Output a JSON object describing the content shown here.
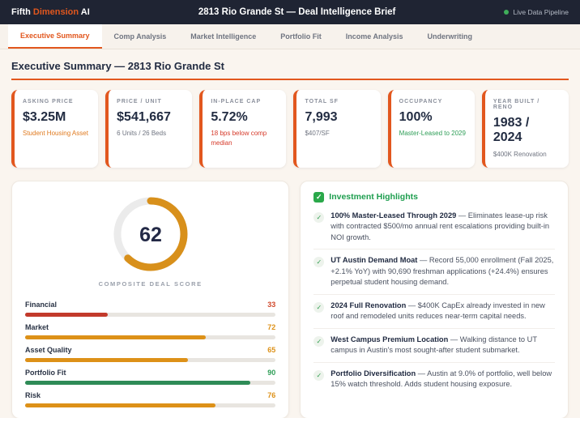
{
  "colors": {
    "accent_orange": "#e2571e",
    "amber": "#dd9118",
    "red": "#c23a2b",
    "green": "#2e8b57",
    "green_text": "#1e9e4f",
    "navy": "#1f2433"
  },
  "header": {
    "brand_part1": "Fifth",
    "brand_part2": "Dimension",
    "brand_part3": "AI",
    "title": "2813 Rio Grande St — Deal Intelligence Brief",
    "status": "Live Data Pipeline"
  },
  "tabs": [
    {
      "label": "Executive Summary",
      "active": true
    },
    {
      "label": "Comp Analysis",
      "active": false
    },
    {
      "label": "Market Intelligence",
      "active": false
    },
    {
      "label": "Portfolio Fit",
      "active": false
    },
    {
      "label": "Income Analysis",
      "active": false
    },
    {
      "label": "Underwriting",
      "active": false
    }
  ],
  "section_title": "Executive Summary — 2813 Rio Grande St",
  "kpis": [
    {
      "label": "ASKING PRICE",
      "value": "$3.25M",
      "sub": "Student Housing Asset",
      "sub_color": "#e07a1f"
    },
    {
      "label": "PRICE / UNIT",
      "value": "$541,667",
      "sub": "6 Units / 26 Beds",
      "sub_color": "#6f7480"
    },
    {
      "label": "IN-PLACE CAP",
      "value": "5.72%",
      "sub": "18 bps below comp median",
      "sub_color": "#d63b2b"
    },
    {
      "label": "TOTAL SF",
      "value": "7,993",
      "sub": "$407/SF",
      "sub_color": "#6f7480"
    },
    {
      "label": "OCCUPANCY",
      "value": "100%",
      "sub": "Master-Leased to 2029",
      "sub_color": "#2e9e57"
    },
    {
      "label": "YEAR BUILT / RENO",
      "value": "1983 / 2024",
      "sub": "$400K Renovation",
      "sub_color": "#6f7480"
    }
  ],
  "chart_data": [
    {
      "type": "donut-gauge",
      "title": "COMPOSITE DEAL SCORE",
      "value": 62,
      "max": 100,
      "arc_color": "#d8901b",
      "track_color": "#ebebeb"
    },
    {
      "type": "bar",
      "title": "Deal score components",
      "categories": [
        "Financial",
        "Market",
        "Asset Quality",
        "Portfolio Fit",
        "Risk"
      ],
      "values": [
        33,
        72,
        65,
        90,
        76
      ],
      "colors": [
        "#c23a2b",
        "#dd9118",
        "#dd9118",
        "#2e8b57",
        "#dd9118"
      ],
      "xlim": [
        0,
        100
      ]
    }
  ],
  "deal_score": {
    "score": "62",
    "label": "COMPOSITE DEAL SCORE",
    "bars": [
      {
        "name": "Financial",
        "value": 33,
        "color": "#c23a2b",
        "value_color": "#d1492c"
      },
      {
        "name": "Market",
        "value": 72,
        "color": "#dd9118",
        "value_color": "#dd9118"
      },
      {
        "name": "Asset Quality",
        "value": 65,
        "color": "#dd9118",
        "value_color": "#dd9118"
      },
      {
        "name": "Portfolio Fit",
        "value": 90,
        "color": "#2e8b57",
        "value_color": "#2e9e57"
      },
      {
        "name": "Risk",
        "value": 76,
        "color": "#dd9118",
        "value_color": "#dd9118"
      }
    ]
  },
  "highlights": {
    "title": "Investment Highlights",
    "badge_icon": "check",
    "items": [
      {
        "title": "100% Master-Leased Through 2029",
        "body": "— Eliminates lease-up risk with contracted $500/mo annual rent escalations providing built-in NOI growth."
      },
      {
        "title": "UT Austin Demand Moat",
        "body": "— Record 55,000 enrollment (Fall 2025, +2.1% YoY) with 90,690 freshman applications (+24.4%) ensures perpetual student housing demand."
      },
      {
        "title": "2024 Full Renovation",
        "body": "— $400K CapEx already invested in new roof and remodeled units reduces near-term capital needs."
      },
      {
        "title": "West Campus Premium Location",
        "body": "— Walking distance to UT campus in Austin's most sought-after student submarket."
      },
      {
        "title": "Portfolio Diversification",
        "body": "— Austin at 9.0% of portfolio, well below 15% watch threshold. Adds student housing exposure."
      }
    ]
  }
}
